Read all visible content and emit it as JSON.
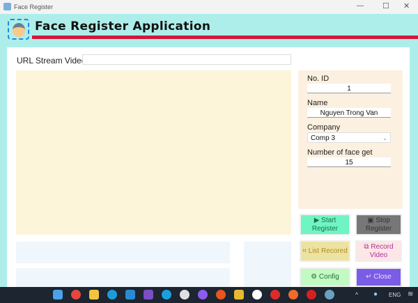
{
  "window": {
    "title": "Face Register",
    "controls": [
      "minimize",
      "maximize",
      "close"
    ]
  },
  "header": {
    "title": "Face Register Application",
    "logo_icon": "face-scan-icon"
  },
  "url": {
    "label": "URL Stream Video",
    "value": ""
  },
  "form": {
    "id_label": "No. ID",
    "id_value": "1",
    "name_label": "Name",
    "name_value": "Nguyen Trong Van",
    "company_label": "Company",
    "company_value": "Comp 3",
    "faces_label": "Number of face get",
    "faces_value": "15"
  },
  "buttons": {
    "start": {
      "icon": "▶",
      "label": "Start Register"
    },
    "stop": {
      "icon": "▣",
      "label": "Stop Register"
    },
    "list": {
      "icon": "⌗",
      "label": "List Recored"
    },
    "record": {
      "icon": "⧉",
      "label": "Record Video"
    },
    "config": {
      "icon": "⚙",
      "label": "Config"
    },
    "close": {
      "icon": "↵",
      "label": "Close"
    }
  },
  "taskbar": {
    "lang": "ENG",
    "apps": [
      "windows",
      "chrome",
      "explorer",
      "edge",
      "vscode",
      "visual-studio",
      "skype",
      "slack",
      "messenger",
      "ubuntu",
      "app",
      "zalo",
      "anydesk",
      "postman",
      "pokeball",
      "face-register"
    ],
    "colors": [
      "#4aa3e8",
      "#e8453c",
      "#f3c341",
      "#1e9bd7",
      "#2a8ad4",
      "#7c4dc4",
      "#1a9fe0",
      "#e0e0e0",
      "#8a5cf0",
      "#e65522",
      "#e8b830",
      "#fff",
      "#e02a2a",
      "#f26a2a",
      "#d62020",
      "#6aa0c0"
    ]
  }
}
